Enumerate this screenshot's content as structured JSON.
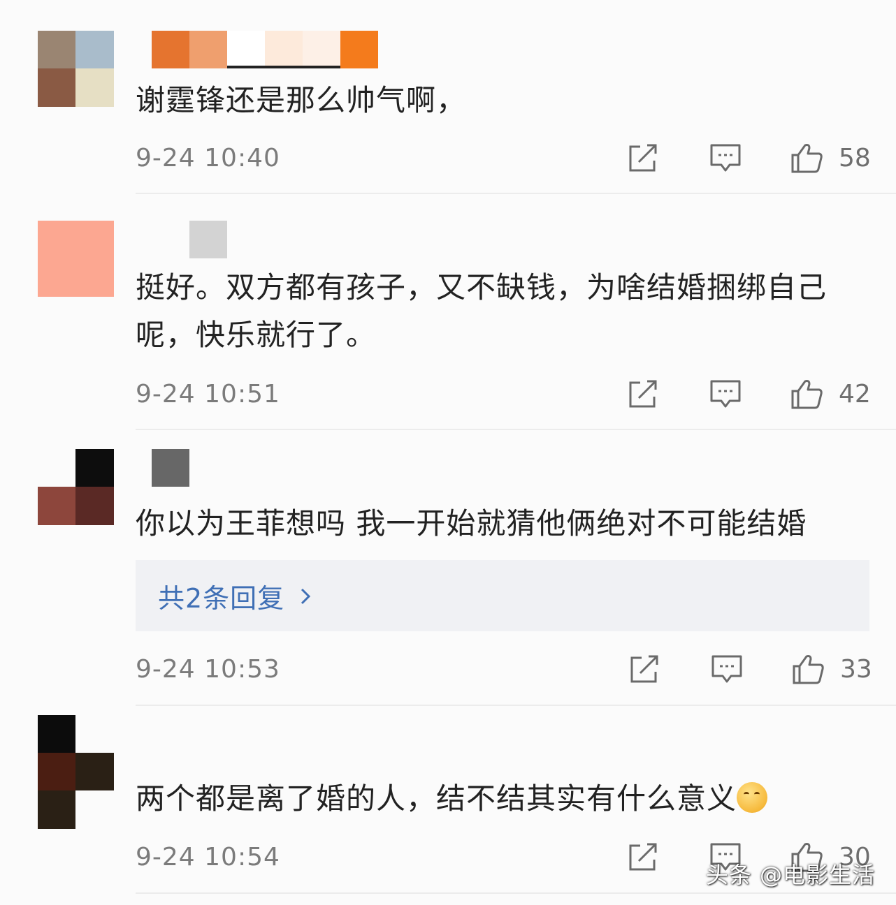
{
  "comments": [
    {
      "avatar_colors": [
        "#9a8572",
        "#a9bccb",
        "#8a5a44",
        "#e6dfc4"
      ],
      "name_mosaic_colors": [
        "#e5742f",
        "#ef9f6e",
        "#ffffff",
        "#fdeadb",
        "#fdf0e7",
        "#f47b1c"
      ],
      "text": "谢霆锋还是那么帅气啊，",
      "time": "9-24 10:40",
      "likes": "58"
    },
    {
      "avatar_colors": [
        "#fca791",
        "#fca791",
        "#fca791",
        "#fca791"
      ],
      "name_mosaic_colors": [
        "#fbfbfb",
        "#d3d3d3"
      ],
      "text": "挺好。双方都有孩子，又不缺钱，为啥结婚捆绑自己呢，快乐就行了。",
      "time": "9-24 10:51",
      "likes": "42"
    },
    {
      "avatar_colors": [
        "#fbfbfb",
        "#0d0d0d",
        "#8d463c",
        "#5a2925"
      ],
      "name_mosaic_colors": [
        "#676767"
      ],
      "text": "你以为王菲想吗 我一开始就猜他俩绝对不可能结婚",
      "reply_label": "共2条回复",
      "time": "9-24 10:53",
      "likes": "33"
    },
    {
      "avatar_colors": [
        "#0c0c0c",
        "#fbfbfb",
        "#4b1e12",
        "#2a2015",
        "#2a2015",
        "#fbfbfb"
      ],
      "text": "两个都是离了婚的人，结不结其实有什么意义",
      "emoji": "face-emoji",
      "time": "9-24 10:54",
      "likes": "30"
    }
  ],
  "icons": {
    "share": "share-icon",
    "comment": "comment-icon",
    "like": "thumbs-up-icon"
  },
  "watermark": "头条 @电影生活",
  "colors": {
    "link": "#3f6fb5",
    "text": "#222222",
    "meta": "#7b7b7b"
  }
}
